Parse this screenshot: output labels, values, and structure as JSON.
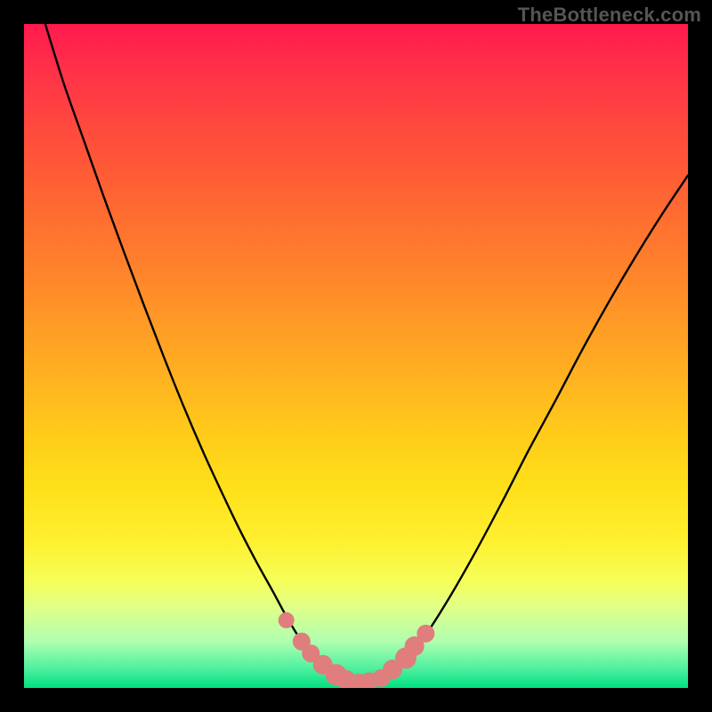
{
  "watermark": "TheBottleneck.com",
  "colors": {
    "curve_stroke": "#000000",
    "marker_fill": "#e07d7d",
    "background_black": "#000000"
  },
  "chart_data": {
    "type": "line",
    "title": "",
    "xlabel": "",
    "ylabel": "",
    "xlim": [
      0,
      1
    ],
    "ylim": [
      0,
      1
    ],
    "grid": false,
    "legend": false,
    "series": [
      {
        "name": "curve",
        "x": [
          0.032,
          0.06,
          0.09,
          0.12,
          0.15,
          0.18,
          0.21,
          0.24,
          0.27,
          0.3,
          0.325,
          0.35,
          0.375,
          0.395,
          0.415,
          0.435,
          0.455,
          0.475,
          0.5,
          0.525,
          0.55,
          0.575,
          0.605,
          0.64,
          0.68,
          0.72,
          0.76,
          0.8,
          0.84,
          0.88,
          0.92,
          0.96,
          1.0
        ],
        "y": [
          1.0,
          0.91,
          0.825,
          0.74,
          0.658,
          0.578,
          0.5,
          0.425,
          0.355,
          0.29,
          0.238,
          0.19,
          0.145,
          0.108,
          0.075,
          0.048,
          0.028,
          0.015,
          0.008,
          0.01,
          0.02,
          0.042,
          0.08,
          0.135,
          0.205,
          0.28,
          0.358,
          0.432,
          0.508,
          0.58,
          0.648,
          0.712,
          0.772
        ]
      }
    ],
    "markers": {
      "name": "highlight-points",
      "x": [
        0.395,
        0.418,
        0.432,
        0.45,
        0.47,
        0.485,
        0.505,
        0.52,
        0.538,
        0.555,
        0.575,
        0.588,
        0.605
      ],
      "y": [
        0.102,
        0.07,
        0.052,
        0.035,
        0.02,
        0.012,
        0.008,
        0.01,
        0.015,
        0.028,
        0.045,
        0.063,
        0.082
      ],
      "r": [
        9,
        10,
        10,
        11,
        12,
        11,
        10,
        10,
        10,
        11,
        12,
        11,
        10
      ]
    }
  }
}
